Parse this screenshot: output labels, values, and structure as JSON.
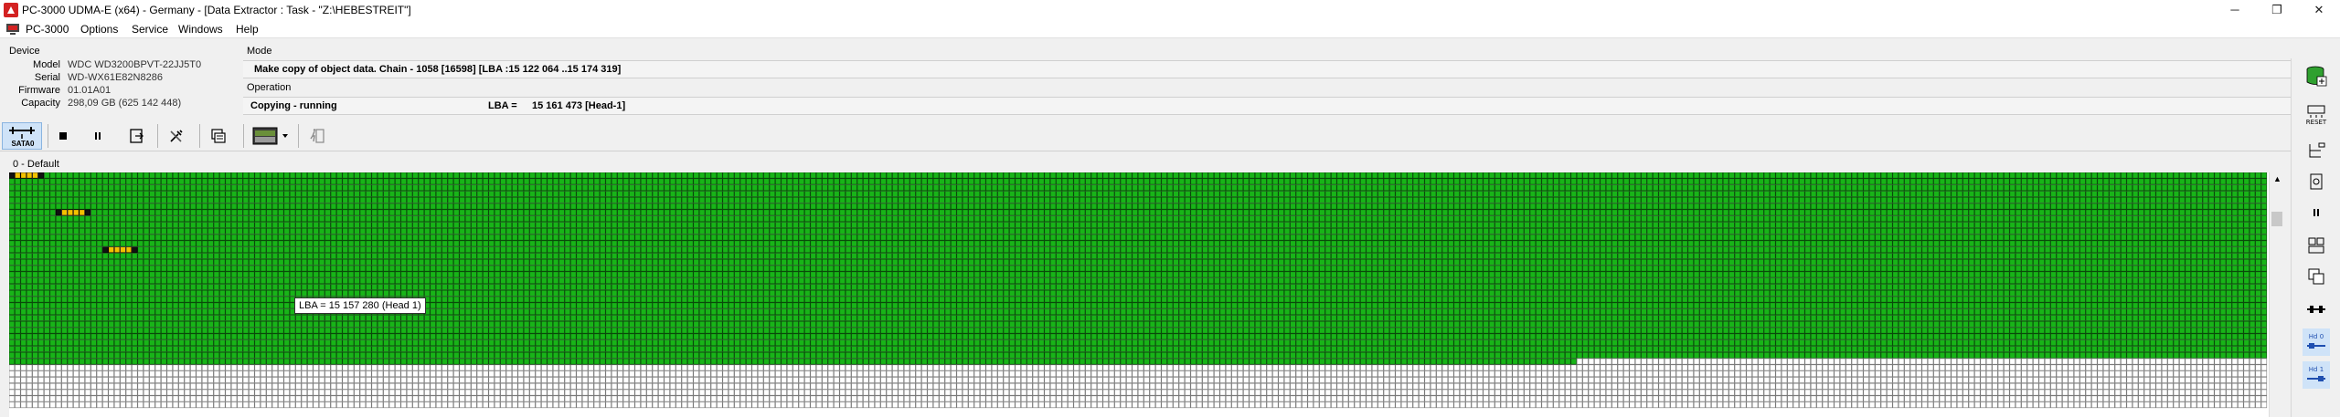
{
  "window": {
    "title": "PC-3000 UDMA-E (x64) - Germany - [Data Extractor : Task - \"Z:\\HEBESTREIT\"]",
    "minimize": "─",
    "restore": "❐",
    "close": "✕"
  },
  "menubar": {
    "items": [
      "PC-3000",
      "Options",
      "Service",
      "Windows",
      "Help"
    ]
  },
  "device": {
    "header": "Device",
    "model_label": "Model",
    "model": "WDC WD3200BPVT-22JJ5T0",
    "serial_label": "Serial",
    "serial": "WD-WX61E82N8286",
    "firmware_label": "Firmware",
    "firmware": "01.01A01",
    "capacity_label": "Capacity",
    "capacity": "298,09 GB (625 142 448)"
  },
  "mode": {
    "header": "Mode",
    "text": "Make copy of object data. Chain - 1058 [16598] [LBA :15 122 064 ..15 174 319]"
  },
  "operation": {
    "header": "Operation",
    "status": "Copying - running",
    "lba_label": "LBA =",
    "lba_value": "15 161 473  [Head-1]"
  },
  "toolbar": {
    "sata_label": "SATA0",
    "buttons": [
      "stop-icon",
      "pause-icon",
      "export-icon",
      "tools-icon",
      "copy-icon",
      "image-icon",
      "chevron-down-icon",
      "exit-icon"
    ]
  },
  "map": {
    "label": "0 - Default",
    "tooltip": "LBA =  15 157 280 (Head 1)",
    "colors": {
      "good": "#18b418",
      "good_border": "#0a4a0a",
      "empty": "#ffffff",
      "empty_border": "#7a7a7a",
      "reading": "#f2c200",
      "reading_border": "#000000"
    },
    "green_full_rows": 30,
    "green_last_row_blocks": 268,
    "total_rows": 38
  },
  "right_tools": {
    "reset_label": "RESET",
    "hd0_label": "Hd 0",
    "hd1_label": "Hd 1"
  }
}
